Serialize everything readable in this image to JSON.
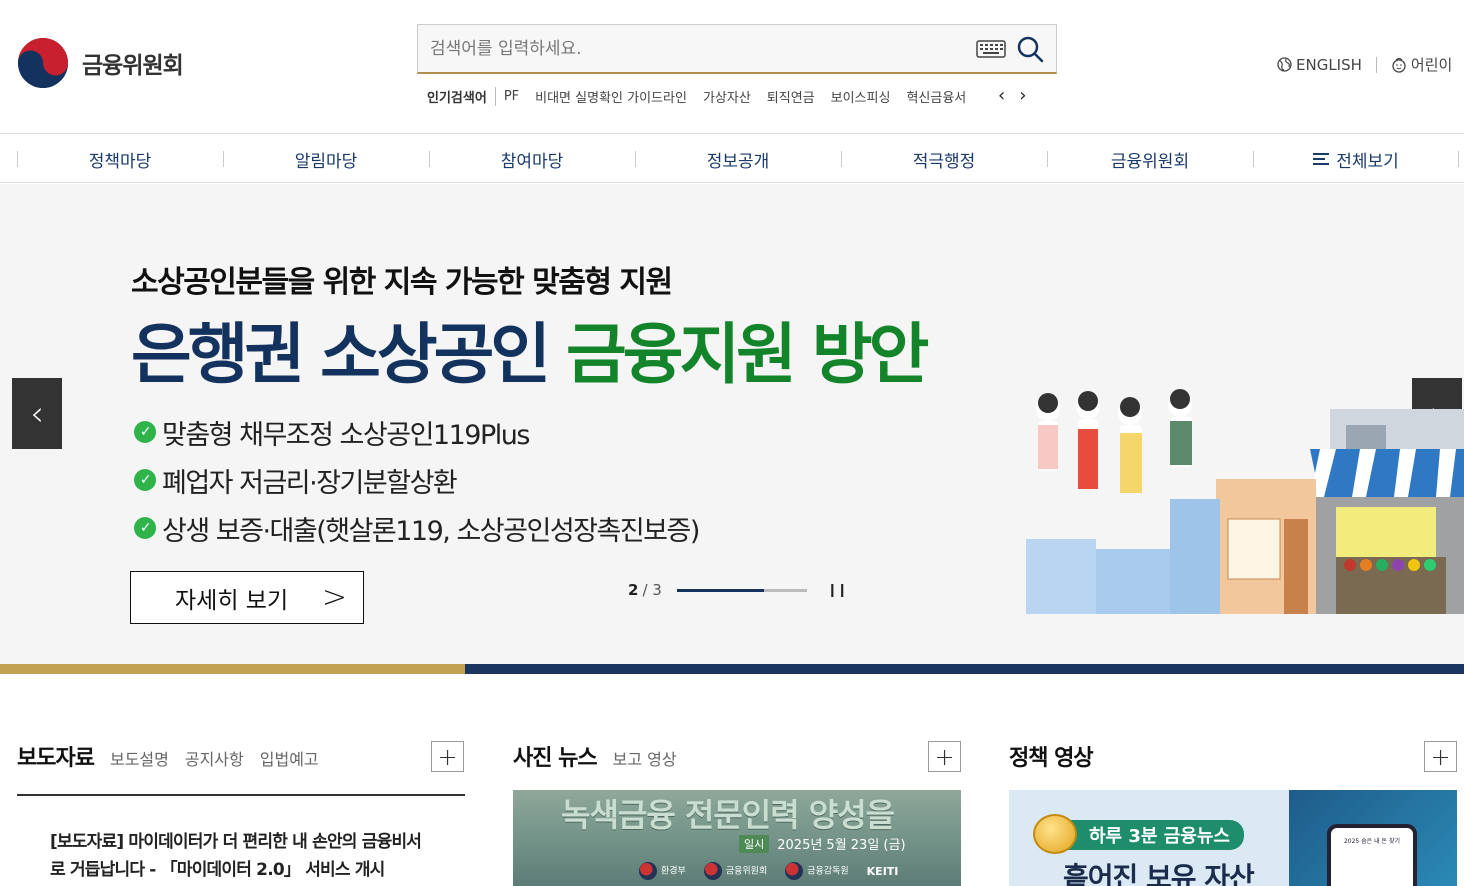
{
  "header": {
    "logo_text": "금융위원회",
    "search": {
      "placeholder": "검색어를 입력하세요."
    },
    "popular": {
      "label": "인기검색어",
      "keywords": [
        "PF",
        "비대면 실명확인 가이드라인",
        "가상자산",
        "퇴직연금",
        "보이스피싱",
        "혁신금융서"
      ]
    },
    "util": {
      "english": "ENGLISH",
      "kids": "어린이"
    }
  },
  "gnb": {
    "items": [
      "정책마당",
      "알림마당",
      "참여마당",
      "정보공개",
      "적극행정",
      "금융위원회",
      "전체보기"
    ]
  },
  "banner": {
    "subtitle": "소상공인분들을 위한 지속 가능한 맞춤형 지원",
    "title_part1": "은행권 소상공인",
    "title_part2": "금융지원 방안",
    "points": [
      "맞춤형 채무조정 소상공인119Plus",
      "폐업자 저금리·장기분할상환",
      "상생 보증·대출(햇살론119, 소상공인성장촉진보증)"
    ],
    "more_label": "자세히 보기",
    "pager": {
      "current": "2",
      "total": "/ 3",
      "progress": 0.67
    },
    "colors": {
      "navy": "#13335e",
      "green": "#13842a"
    }
  },
  "sections": {
    "press": {
      "title": "보도자료",
      "tabs": [
        "보도설명",
        "공지사항",
        "입법예고"
      ],
      "item": "[보도자료] 마이데이터가 더 편리한 내 손안의 금융비서로 거듭납니다 - 「마이데이터 2.0」 서비스 개시"
    },
    "photo": {
      "title": "사진 뉴스",
      "tabs": [
        "보고 영상"
      ],
      "thumb_title": "녹색금융 전문인력 양성을",
      "thumb_tag": "일시",
      "thumb_date": "2025년 5월 23일 (금)",
      "thumb_logos": [
        "환경부",
        "금융위원회",
        "금융감독원",
        "KEITI"
      ]
    },
    "video": {
      "title": "정책 영상",
      "badge": "하루 3분 금융뉴스",
      "thumb_big": "흩어진 보유 자산",
      "phone_text": "2025 숨은 내 돈 찾기"
    }
  }
}
